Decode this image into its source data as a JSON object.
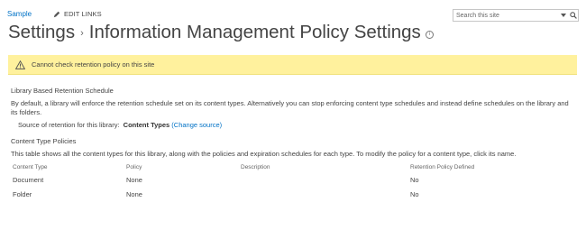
{
  "nav": {
    "site_link": "Sample",
    "edit_links": "EDIT LINKS"
  },
  "search": {
    "placeholder": "Search this site"
  },
  "title": {
    "root": "Settings",
    "separator": "›",
    "page": "Information Management Policy Settings"
  },
  "warning": {
    "text": "Cannot check retention policy on this site"
  },
  "library_schedule": {
    "heading": "Library Based Retention Schedule",
    "description": "By default, a library will enforce the retention schedule set on its content types. Alternatively you can stop enforcing content type schedules and instead define schedules on the library and its folders.",
    "source_label": "Source of retention for this library:",
    "source_value": "Content Types",
    "change_source": "(Change source)"
  },
  "content_type_policies": {
    "heading": "Content Type Policies",
    "description": "This table shows all the content types for this library, along with the policies and expiration schedules for each type. To modify the policy for a content type, click its name.",
    "columns": [
      "Content Type",
      "Policy",
      "Description",
      "Retention Policy Defined"
    ],
    "rows": [
      {
        "name": "Document",
        "policy": "None",
        "description": "",
        "retention": "No"
      },
      {
        "name": "Folder",
        "policy": "None",
        "description": "",
        "retention": "No"
      }
    ]
  }
}
